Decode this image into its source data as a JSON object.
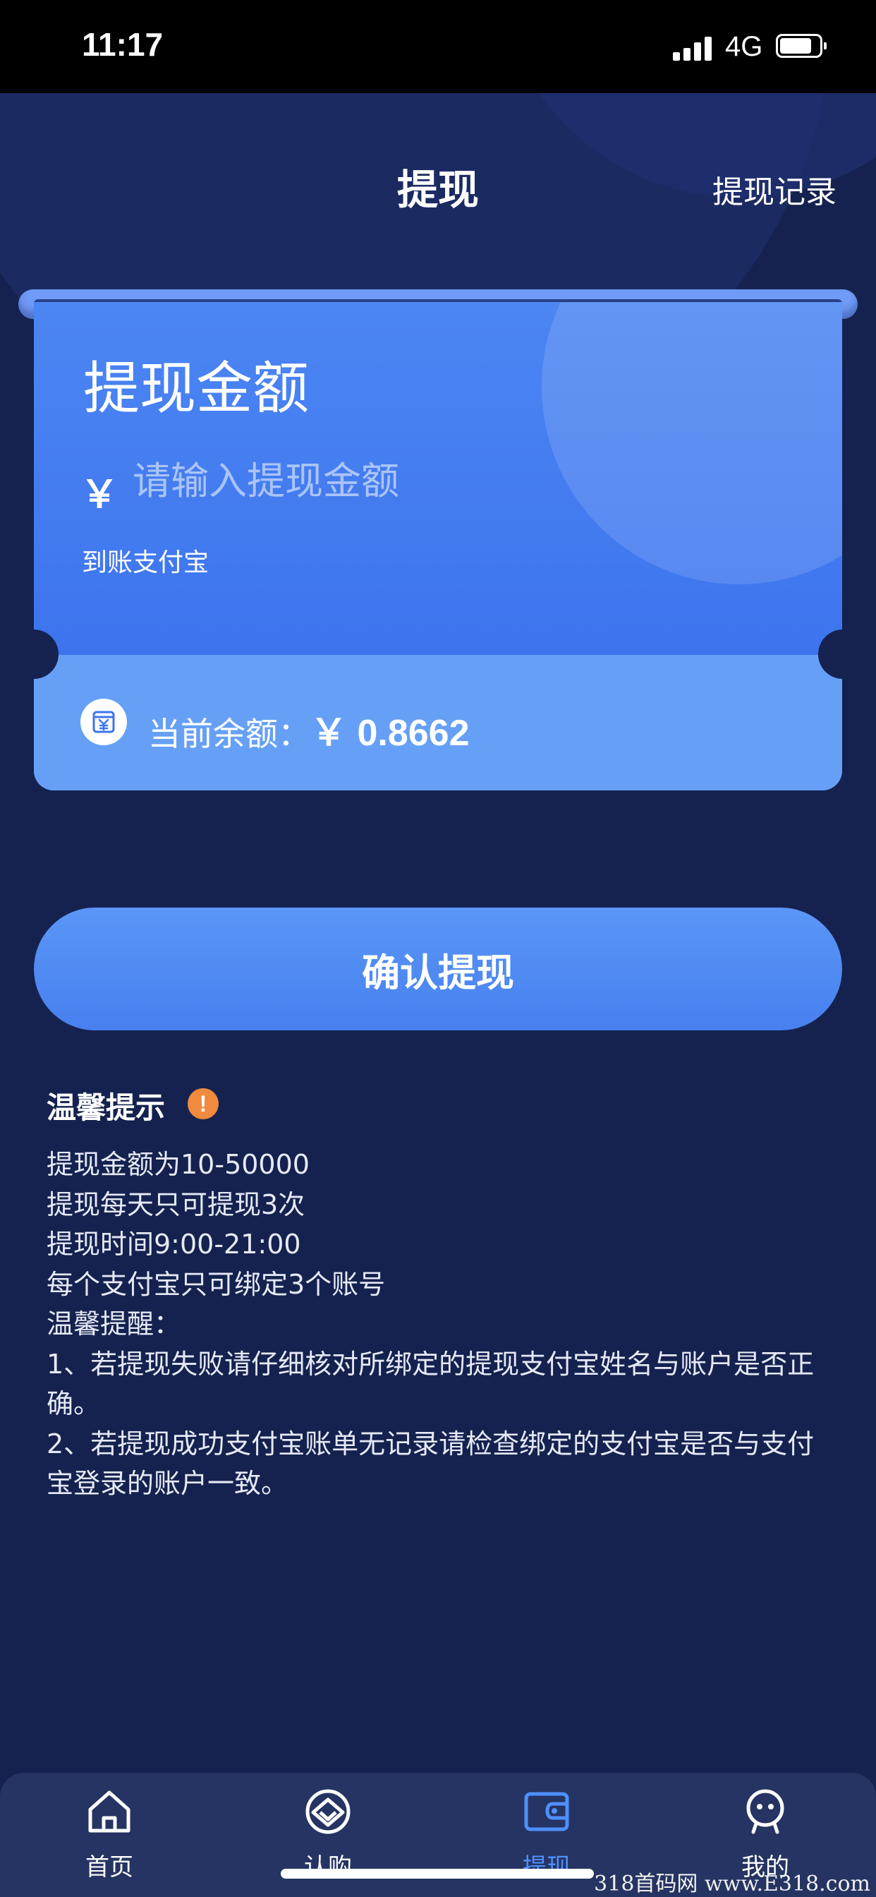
{
  "status_bar": {
    "time": "11:17",
    "network": "4G"
  },
  "header": {
    "title": "提现",
    "history_link": "提现记录"
  },
  "card": {
    "amount_title": "提现金额",
    "currency_symbol": "￥",
    "amount_placeholder": "请输入提现金额",
    "amount_value": "",
    "destination_label": "到账支付宝",
    "balance_label": "当前余额：",
    "balance_value": "￥ 0.8662"
  },
  "confirm_button": {
    "label": "确认提现"
  },
  "tips": {
    "title": "温馨提示",
    "warning_glyph": "!",
    "lines": [
      "提现金额为10-50000",
      "提现每天只可提现3次",
      "提现时间9:00-21:00",
      "每个支付宝只可绑定3个账号",
      "温馨提醒：",
      "1、若提现失败请仔细核对所绑定的提现支付宝姓名与账户是否正确。",
      "2、若提现成功支付宝账单无记录请检查绑定的支付宝是否与支付宝登录的账户一致。"
    ]
  },
  "tab_bar": {
    "items": [
      {
        "label": "首页",
        "icon": "home-icon",
        "active": false
      },
      {
        "label": "认购",
        "icon": "subscribe-icon",
        "active": false
      },
      {
        "label": "提现",
        "icon": "wallet-icon",
        "active": true
      },
      {
        "label": "我的",
        "icon": "profile-icon",
        "active": false
      }
    ]
  },
  "colors": {
    "background": "#15224f",
    "card_blue": "#4f8bf5",
    "active_tab": "#4e90ff",
    "warning": "#ef8a3e"
  },
  "watermark": "318首码网 www.E318.com"
}
